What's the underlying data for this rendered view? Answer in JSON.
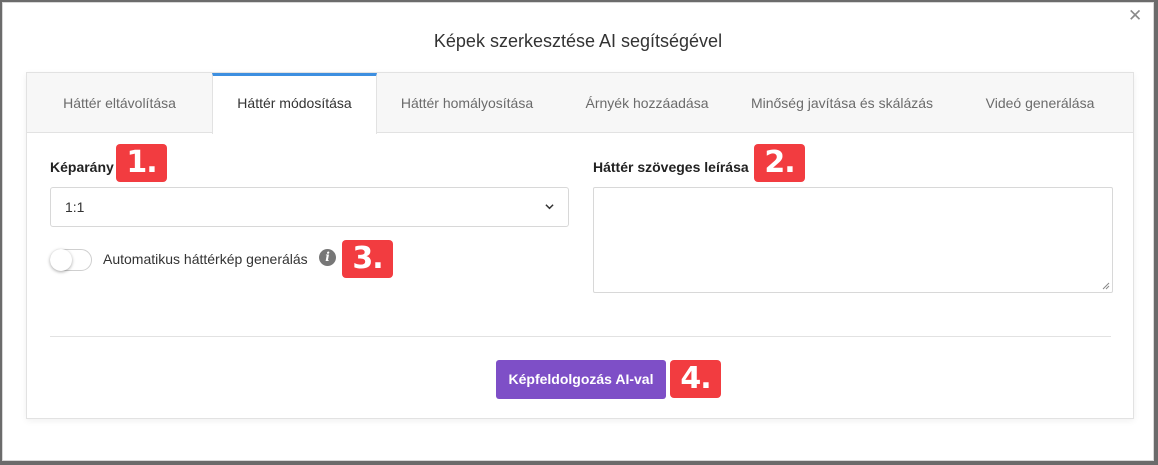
{
  "dialog": {
    "title": "Képek szerkesztése AI segítségével",
    "close_icon": "close-icon"
  },
  "tabs": [
    {
      "label": "Háttér eltávolítása",
      "active": false
    },
    {
      "label": "Háttér módosítása",
      "active": true
    },
    {
      "label": "Háttér homályosítása",
      "active": false
    },
    {
      "label": "Árnyék hozzáadása",
      "active": false
    },
    {
      "label": "Minőség javítása és skálázás",
      "active": false
    },
    {
      "label": "Videó generálása",
      "active": false
    }
  ],
  "form": {
    "aspect_ratio_label": "Képarány",
    "aspect_ratio_value": "1:1",
    "auto_bg_label": "Automatikus háttérkép generálás",
    "auto_bg_enabled": false,
    "bg_description_label": "Háttér szöveges leírása",
    "bg_description_value": ""
  },
  "action": {
    "button_label": "Képfeldolgozás AI-val"
  },
  "badges": {
    "one": "1.",
    "two": "2.",
    "three": "3.",
    "four": "4."
  },
  "colors": {
    "accent_tab": "#3d8fe0",
    "button": "#7e4fc7",
    "badge": "#f23c40"
  }
}
